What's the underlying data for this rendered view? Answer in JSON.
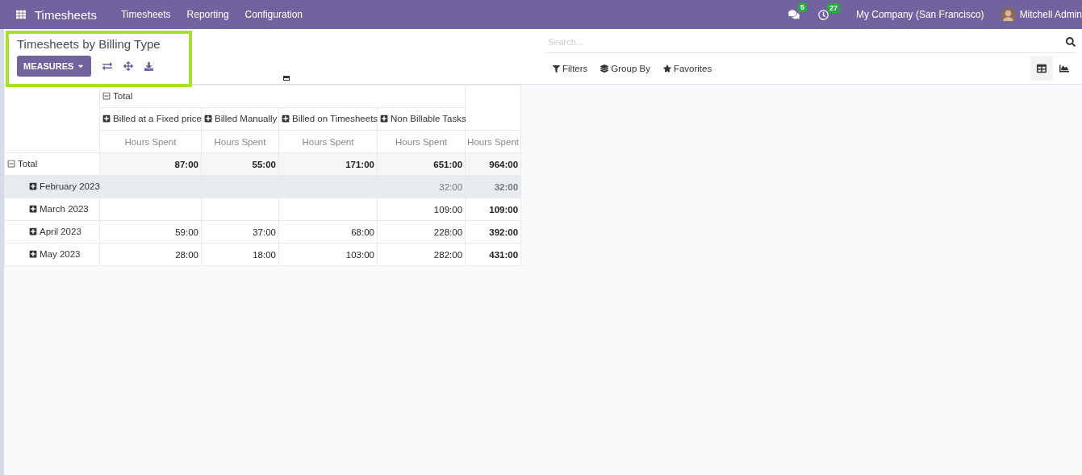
{
  "navbar": {
    "app_name": "Timesheets",
    "menu": [
      "Timesheets",
      "Reporting",
      "Configuration"
    ],
    "messages_badge": "5",
    "activities_badge": "27",
    "company": "My Company (San Francisco)",
    "user": "Mitchell Admin"
  },
  "control_panel": {
    "title": "Timesheets by Billing Type",
    "measures_button": "MEASURES",
    "search": {
      "placeholder": "Search..."
    },
    "filters": [
      {
        "kind": "filter",
        "label": "Filters"
      },
      {
        "kind": "group",
        "label": "Group By"
      },
      {
        "kind": "favorite",
        "label": "Favorites"
      }
    ],
    "views": [
      {
        "kind": "pivot",
        "selected": true
      },
      {
        "kind": "graph",
        "selected": false
      }
    ]
  },
  "pivot": {
    "column_header": {
      "label": "Total",
      "expanded": true
    },
    "column_groups": [
      {
        "label": "Billed at a Fixed price",
        "expanded": false
      },
      {
        "label": "Billed Manually",
        "expanded": false
      },
      {
        "label": "Billed on Timesheets",
        "expanded": false
      },
      {
        "label": "Non Billable Tasks",
        "expanded": false
      }
    ],
    "measure_headers": [
      "Hours Spent",
      "Hours Spent",
      "Hours Spent",
      "Hours Spent",
      "Hours Spent"
    ],
    "rows": [
      {
        "label": "Total",
        "expanded": true,
        "highlighted": false,
        "cells": [
          "87:00",
          "55:00",
          "171:00",
          "651:00",
          "964:00"
        ],
        "children": [
          {
            "label": "February 2023",
            "expanded": false,
            "highlighted": true,
            "cells": [
              null,
              null,
              null,
              "32:00",
              "32:00"
            ]
          },
          {
            "label": "March 2023",
            "expanded": false,
            "highlighted": false,
            "cells": [
              null,
              null,
              null,
              "109:00",
              "109:00"
            ]
          },
          {
            "label": "April 2023",
            "expanded": false,
            "highlighted": false,
            "cells": [
              "59:00",
              "37:00",
              "68:00",
              "228:00",
              "392:00"
            ]
          },
          {
            "label": "May 2023",
            "expanded": false,
            "highlighted": false,
            "cells": [
              "28:00",
              "18:00",
              "103:00",
              "282:00",
              "431:00"
            ]
          }
        ]
      }
    ]
  }
}
